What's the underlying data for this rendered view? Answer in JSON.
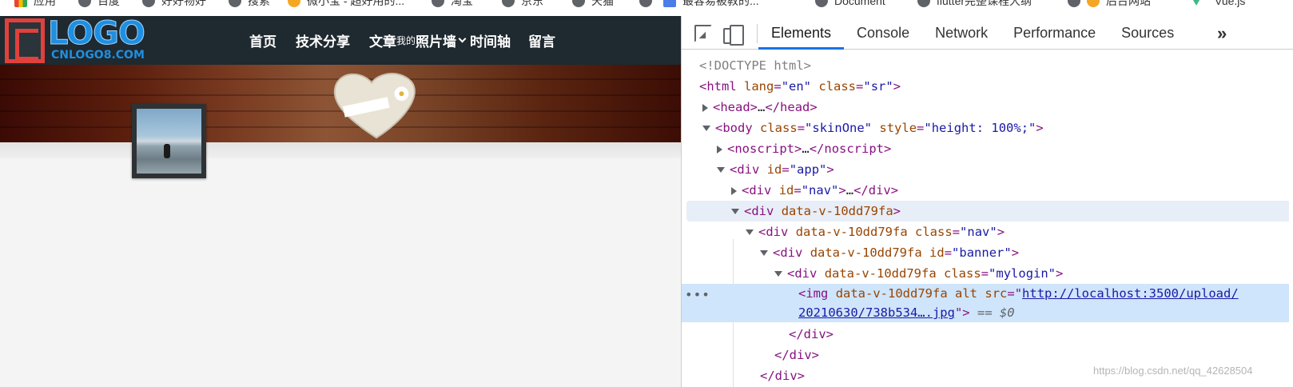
{
  "bookmarks": [
    {
      "label": "应用",
      "icon": "apps-icon"
    },
    {
      "label": "百度",
      "icon": "globe-icon"
    },
    {
      "label": "好好物好",
      "icon": "globe-icon"
    },
    {
      "label": "搜索",
      "icon": "globe-icon"
    },
    {
      "label": "微小宝 - 超好用的...",
      "icon": "emoji-icon"
    },
    {
      "label": "淘宝",
      "icon": "globe-icon"
    },
    {
      "label": "京东",
      "icon": "globe-icon"
    },
    {
      "label": "天猫",
      "icon": "globe-icon"
    },
    {
      "label": "最容易被教的...",
      "icon": "doc-icon"
    },
    {
      "label": "Document",
      "icon": "globe-icon"
    },
    {
      "label": "flutter完整课程大纲",
      "icon": "globe-icon"
    },
    {
      "label": "后台网站",
      "icon": "emoji-icon"
    },
    {
      "label": "Vue.js",
      "icon": "vue-icon"
    }
  ],
  "site": {
    "logo_text": "LOGO",
    "logo_sub": "CNLOGO8.COM",
    "nav": {
      "home": "首页",
      "tech": "技术分享",
      "article": "文章",
      "article_small": "我的",
      "photo_wall": "照片墙",
      "timeline": "时间轴",
      "message": "留言"
    }
  },
  "devtools": {
    "tabs": [
      "Elements",
      "Console",
      "Network",
      "Performance",
      "Sources"
    ],
    "active_tab": "Elements",
    "more_label": "»",
    "dom": {
      "doctype": "<!DOCTYPE html>",
      "html_tag": "html",
      "html_lang_attr": "lang",
      "html_lang_val": "\"en\"",
      "html_class_attr": "class",
      "html_class_val": "\"sr\"",
      "head_tag": "head",
      "body_tag": "body",
      "body_class_attr": "class",
      "body_class_val": "\"skinOne\"",
      "body_style_attr": "style",
      "body_style_val": "\"height: 100%;\"",
      "noscript_tag": "noscript",
      "div_tag": "div",
      "app_id_attr": "id",
      "app_id_val": "\"app\"",
      "nav_id_val": "\"nav\"",
      "data_v": "data-v-10dd79fa",
      "class_attr": "class",
      "nav_class_val": "\"nav\"",
      "banner_id_val": "\"banner\"",
      "mylogin_class_val": "\"mylogin\"",
      "img_tag": "img",
      "alt_attr": "alt",
      "src_attr": "src",
      "img_src_1": "http://localhost:3500/upload/",
      "img_src_2": "20210630/738b534….jpg",
      "dollar0": "== $0",
      "ellipsis": "…",
      "dots": "•••"
    }
  },
  "watermark": "https://blog.csdn.net/qq_42628504"
}
